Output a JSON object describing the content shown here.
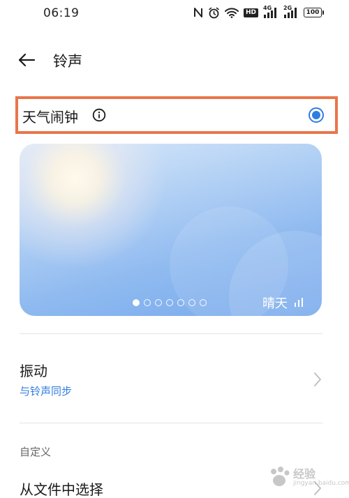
{
  "status_bar": {
    "time": "06:19",
    "hd_badge": "HD",
    "net1_label": "4G",
    "net2_label": "2G",
    "battery": "100"
  },
  "header": {
    "title": "铃声",
    "back_icon": "arrow-left-icon"
  },
  "ringtone": {
    "label": "天气闹钟",
    "info_icon": "info-icon",
    "selected": true,
    "highlight_color": "#e8764a",
    "accent_color": "#2f7de1"
  },
  "weather_card": {
    "label": "晴天",
    "icon": "signal-bars-icon",
    "page_count": 7,
    "active_page": 1
  },
  "vibration": {
    "title": "振动",
    "subtitle": "与铃声同步"
  },
  "custom_section": {
    "header": "自定义",
    "item": "从文件中选择"
  },
  "watermark": {
    "text": "经验",
    "sub": "jingyan.baidu.com"
  }
}
